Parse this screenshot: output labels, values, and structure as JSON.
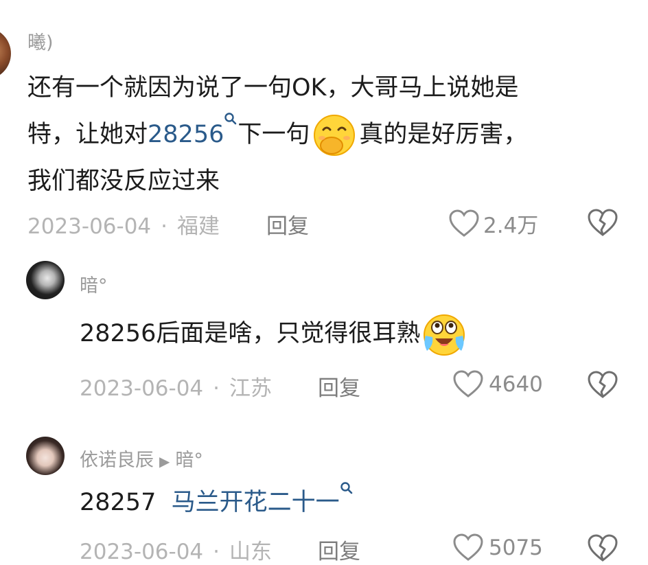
{
  "comments": [
    {
      "username": "曦)",
      "lines": [
        {
          "before": "还有一个就因为说了一句OK，大哥马上说她是"
        },
        {
          "before": "特，让她对",
          "keyword": "28256",
          "after1": "下一句",
          "after2": "真的是好厉害，"
        },
        {
          "before": "我们都没反应过来"
        }
      ],
      "emoji": "covering-mouth-emoji",
      "date": "2023-06-04",
      "location": "福建",
      "reply_label": "回复",
      "likes": "2.4万"
    },
    {
      "username": "暗°",
      "text": "28256后面是啥，只觉得很耳熟",
      "emoji": "crying-laughing-emoji",
      "date": "2023-06-04",
      "location": "江苏",
      "reply_label": "回复",
      "likes": "4640"
    },
    {
      "username": "依诺良辰",
      "reply_to": "暗°",
      "text_prefix": "28257",
      "keyword": "马兰开花二十一",
      "date": "2023-06-04",
      "location": "山东",
      "reply_label": "回复",
      "likes": "5075"
    }
  ],
  "meta_separator": "·",
  "colors": {
    "keyword": "#2a5a8a",
    "meta": "#b4b4b4",
    "username": "#9b9b9b"
  },
  "icons": [
    "heart-outline-icon",
    "broken-heart-icon",
    "search-icon",
    "play-arrow-icon"
  ]
}
